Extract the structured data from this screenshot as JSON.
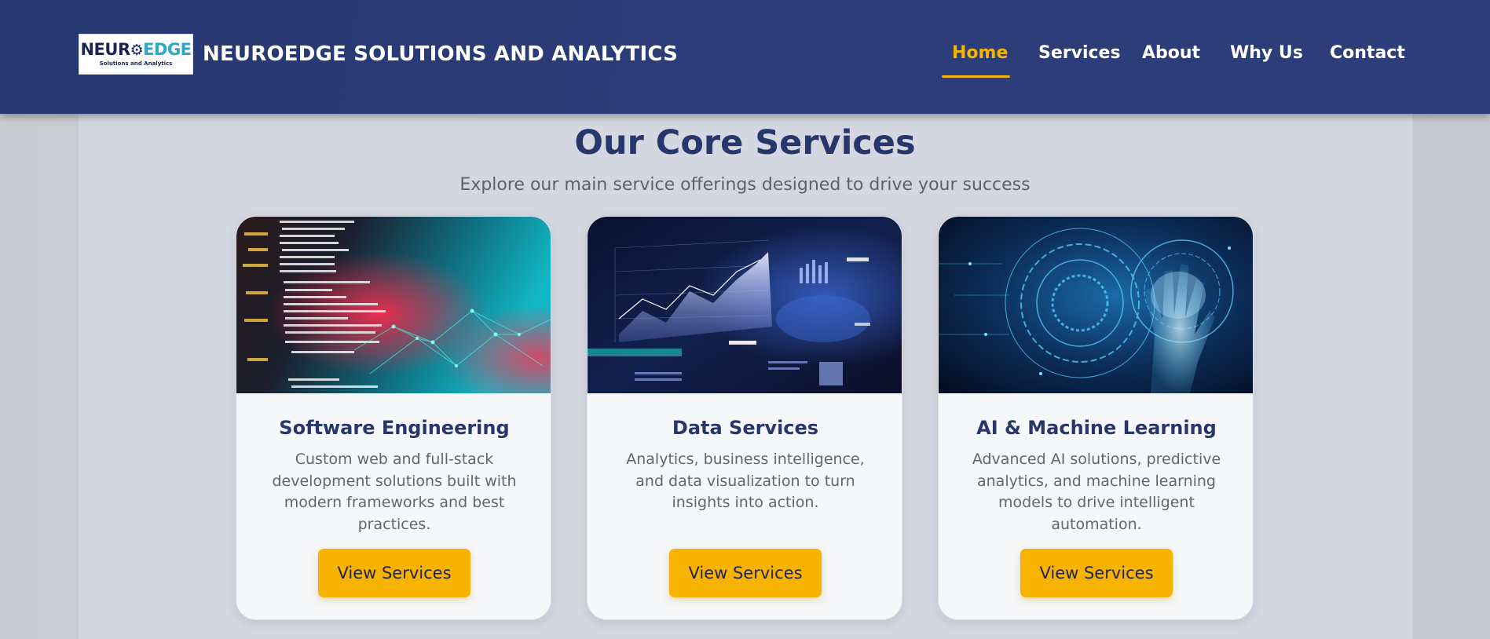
{
  "header": {
    "logo": {
      "word_part1": "NEUR",
      "word_part2": "EDGE",
      "tagline": "Solutions and Analytics"
    },
    "brand_name": "NEUROEDGE SOLUTIONS AND ANALYTICS",
    "nav": [
      {
        "label": "Home",
        "active": true
      },
      {
        "label": "Services",
        "active": false
      },
      {
        "label": "About",
        "active": false
      },
      {
        "label": "Why Us",
        "active": false
      },
      {
        "label": "Contact",
        "active": false
      }
    ]
  },
  "section": {
    "title": "Our Core Services",
    "subtitle": "Explore our main service offerings designed to drive your success"
  },
  "cards": [
    {
      "title": "Software Engineering",
      "description": "Custom web and full-stack development solutions built with modern frameworks and best practices.",
      "button": "View Services"
    },
    {
      "title": "Data Services",
      "description": "Analytics, business intelligence, and data visualization to turn insights into action.",
      "button": "View Services"
    },
    {
      "title": "AI & Machine Learning",
      "description": "Advanced AI solutions, predictive analytics, and machine learning models to drive intelligent automation.",
      "button": "View Services"
    }
  ],
  "colors": {
    "navbar": "#2b3c78",
    "accent": "#f8b200",
    "heading": "#27366b",
    "body_text": "#62666d"
  }
}
